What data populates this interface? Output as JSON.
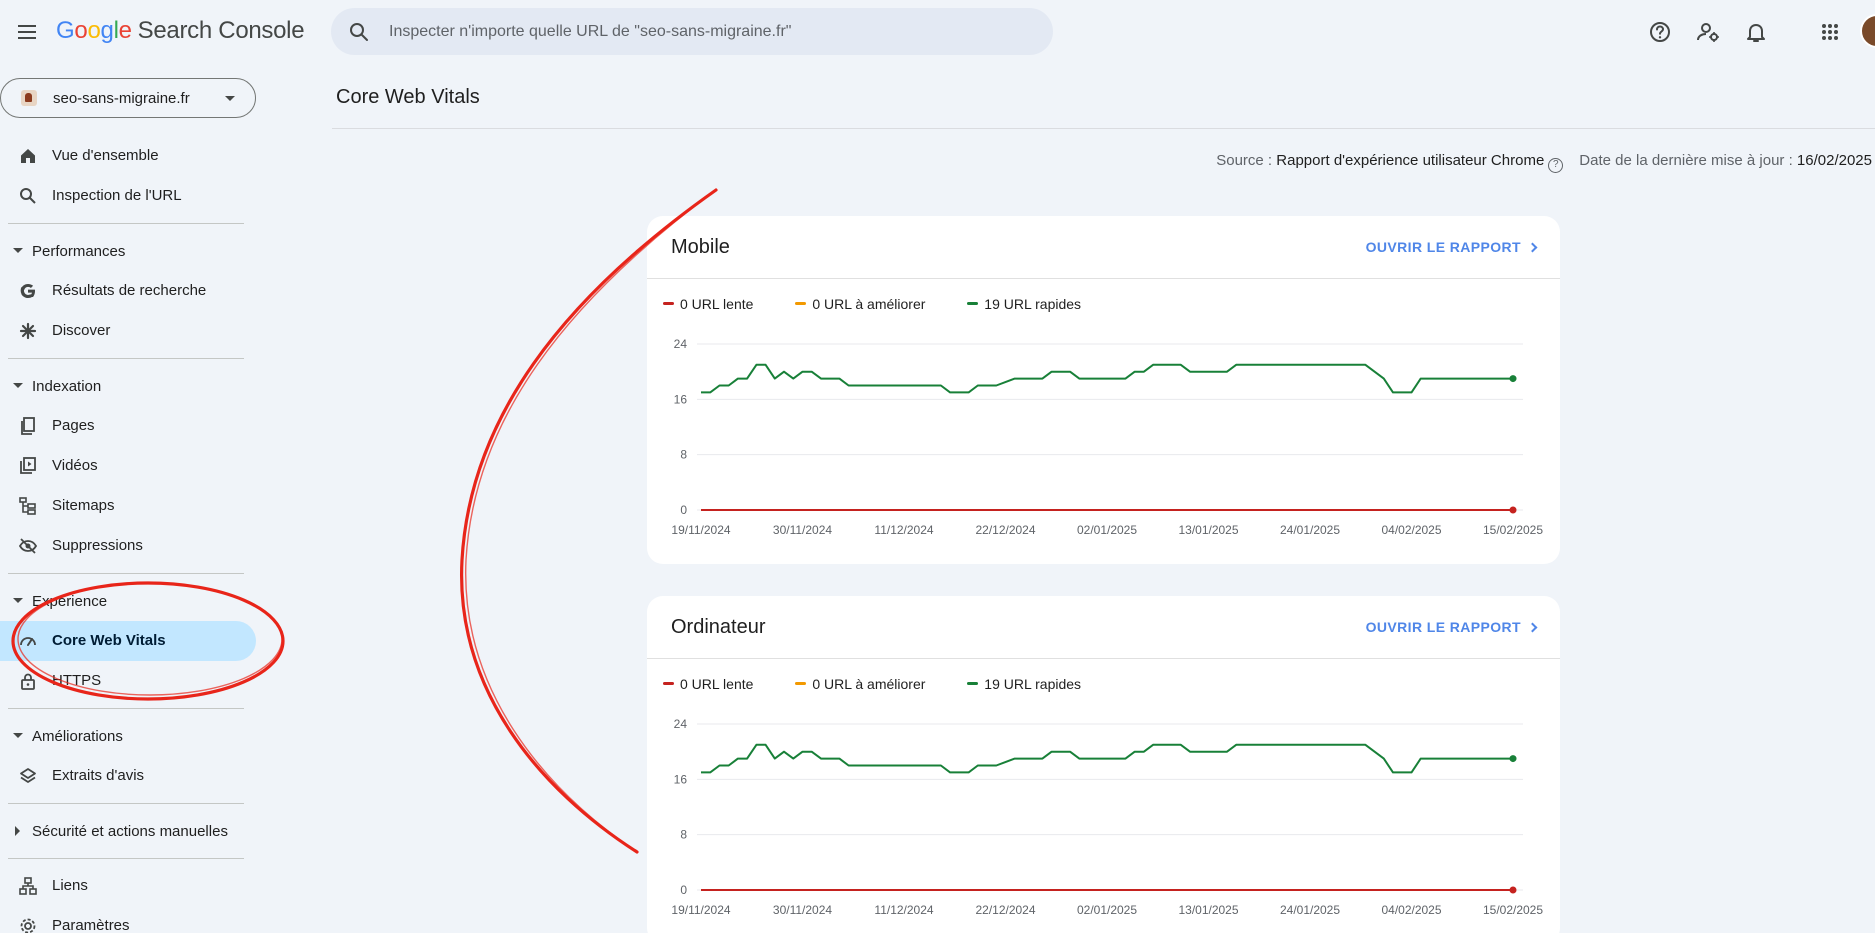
{
  "header": {
    "logo_letters": [
      "G",
      "o",
      "o",
      "g",
      "l",
      "e"
    ],
    "logo_rest": "Search Console",
    "search_placeholder": "Inspecter n'importe quelle URL de \"seo-sans-migraine.fr\"",
    "icons": [
      "help-icon",
      "manage-users-icon",
      "notifications-icon",
      "apps-grid-icon",
      "avatar"
    ]
  },
  "sidebar": {
    "property": "seo-sans-migraine.fr",
    "overview": "Vue d'ensemble",
    "url_inspection": "Inspection de l'URL",
    "performance": {
      "title": "Performances",
      "search_results": "Résultats de recherche",
      "discover": "Discover"
    },
    "indexing": {
      "title": "Indexation",
      "pages": "Pages",
      "videos": "Vidéos",
      "sitemaps": "Sitemaps",
      "removals": "Suppressions"
    },
    "experience": {
      "title": "Expérience",
      "cwv": "Core Web Vitals",
      "https": "HTTPS"
    },
    "enhancements": {
      "title": "Améliorations",
      "review_snippets": "Extraits d'avis"
    },
    "security": {
      "title": "Sécurité et actions manuelles"
    },
    "links": "Liens",
    "settings": "Paramètres"
  },
  "main": {
    "title": "Core Web Vitals",
    "source_label": "Source :",
    "source_value": "Rapport d'expérience utilisateur Chrome",
    "updated_label": "Date de la dernière mise à jour :",
    "updated_value": "16/02/2025",
    "open_report": "OUVRIR LE RAPPORT",
    "colors": {
      "slow": "#c5221f",
      "improve": "#f29900",
      "fast": "#188038",
      "accent": "#4f86e8"
    },
    "cards": [
      {
        "title": "Mobile",
        "legend": [
          "0 URL lente",
          "0 URL à améliorer",
          "19 URL rapides"
        ]
      },
      {
        "title": "Ordinateur",
        "legend": [
          "0 URL lente",
          "0 URL à améliorer",
          "19 URL rapides"
        ]
      }
    ]
  },
  "chart_data": [
    {
      "type": "line",
      "title": "Mobile",
      "x_ticks": [
        "19/11/2024",
        "30/11/2024",
        "11/12/2024",
        "22/12/2024",
        "02/01/2025",
        "13/01/2025",
        "24/01/2025",
        "04/02/2025",
        "15/02/2025"
      ],
      "y_ticks": [
        0,
        8,
        16,
        24
      ],
      "ylim": [
        0,
        24
      ],
      "x_range": [
        "19/11/2024",
        "15/02/2025"
      ],
      "grid": true,
      "series": [
        {
          "name": "URL rapides",
          "color": "#188038",
          "x": [
            "19/11/2024",
            "20/11/2024",
            "21/11/2024",
            "22/11/2024",
            "23/11/2024",
            "24/11/2024",
            "25/11/2024",
            "26/11/2024",
            "27/11/2024",
            "28/11/2024",
            "29/11/2024",
            "30/11/2024",
            "01/12/2024",
            "02/12/2024",
            "04/12/2024",
            "05/12/2024",
            "07/12/2024",
            "15/12/2024",
            "16/12/2024",
            "17/12/2024",
            "18/12/2024",
            "19/12/2024",
            "20/12/2024",
            "21/12/2024",
            "23/12/2024",
            "26/12/2024",
            "27/12/2024",
            "28/12/2024",
            "29/12/2024",
            "30/12/2024",
            "04/01/2025",
            "05/01/2025",
            "06/01/2025",
            "07/01/2025",
            "10/01/2025",
            "11/01/2025",
            "15/01/2025",
            "16/01/2025",
            "30/01/2025",
            "01/02/2025",
            "02/02/2025",
            "03/02/2025",
            "04/02/2025",
            "05/02/2025",
            "15/02/2025"
          ],
          "y": [
            17,
            17,
            18,
            18,
            19,
            19,
            21,
            21,
            19,
            20,
            19,
            20,
            20,
            19,
            19,
            18,
            18,
            18,
            17,
            17,
            17,
            18,
            18,
            18,
            19,
            19,
            20,
            20,
            20,
            19,
            19,
            20,
            20,
            21,
            21,
            20,
            20,
            21,
            21,
            19,
            17,
            17,
            17,
            19,
            19
          ]
        },
        {
          "name": "URL lente",
          "color": "#c5221f",
          "x": [
            "19/11/2024",
            "15/02/2025"
          ],
          "y": [
            0,
            0
          ]
        }
      ]
    },
    {
      "type": "line",
      "title": "Ordinateur",
      "x_ticks": [
        "19/11/2024",
        "30/11/2024",
        "11/12/2024",
        "22/12/2024",
        "02/01/2025",
        "13/01/2025",
        "24/01/2025",
        "04/02/2025",
        "15/02/2025"
      ],
      "y_ticks": [
        0,
        8,
        16,
        24
      ],
      "ylim": [
        0,
        24
      ],
      "x_range": [
        "19/11/2024",
        "15/02/2025"
      ],
      "grid": true,
      "series": [
        {
          "name": "URL rapides",
          "color": "#188038",
          "x": [
            "19/11/2024",
            "20/11/2024",
            "21/11/2024",
            "22/11/2024",
            "23/11/2024",
            "24/11/2024",
            "25/11/2024",
            "26/11/2024",
            "27/11/2024",
            "28/11/2024",
            "29/11/2024",
            "30/11/2024",
            "01/12/2024",
            "02/12/2024",
            "04/12/2024",
            "05/12/2024",
            "07/12/2024",
            "15/12/2024",
            "16/12/2024",
            "17/12/2024",
            "18/12/2024",
            "19/12/2024",
            "20/12/2024",
            "21/12/2024",
            "23/12/2024",
            "26/12/2024",
            "27/12/2024",
            "28/12/2024",
            "29/12/2024",
            "30/12/2024",
            "04/01/2025",
            "05/01/2025",
            "06/01/2025",
            "07/01/2025",
            "10/01/2025",
            "11/01/2025",
            "15/01/2025",
            "16/01/2025",
            "30/01/2025",
            "01/02/2025",
            "02/02/2025",
            "03/02/2025",
            "04/02/2025",
            "05/02/2025",
            "15/02/2025"
          ],
          "y": [
            17,
            17,
            18,
            18,
            19,
            19,
            21,
            21,
            19,
            20,
            19,
            20,
            20,
            19,
            19,
            18,
            18,
            18,
            17,
            17,
            17,
            18,
            18,
            18,
            19,
            19,
            20,
            20,
            20,
            19,
            19,
            20,
            20,
            21,
            21,
            20,
            20,
            21,
            21,
            19,
            17,
            17,
            17,
            19,
            19
          ]
        },
        {
          "name": "URL lente",
          "color": "#c5221f",
          "x": [
            "19/11/2024",
            "15/02/2025"
          ],
          "y": [
            0,
            0
          ]
        }
      ]
    }
  ]
}
